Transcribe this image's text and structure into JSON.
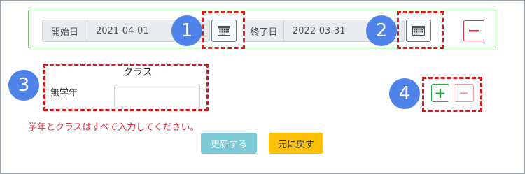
{
  "date_range": {
    "start_label": "開始日",
    "start_value": "2021-04-01",
    "end_label": "終了日",
    "end_value": "2022-03-31"
  },
  "class_section": {
    "header": "クラス",
    "grade_label": "無学年",
    "class_value": ""
  },
  "error_message": "学年とクラスはすべて入力してください。",
  "buttons": {
    "update": "更新する",
    "back": "元に戻す",
    "plus": "+",
    "minus": "−"
  },
  "badges": [
    "1",
    "2",
    "3",
    "4"
  ],
  "colors": {
    "panel_border": "#6cc46c",
    "dashed_highlight": "#d71920",
    "badge": "#4f83e9",
    "error_text": "#dc3545",
    "update_button": "#7ccad6",
    "back_button": "#ffc107",
    "plus": "#28a745",
    "minus": "#dc3545"
  },
  "icons": [
    "calendar-icon",
    "plus-icon",
    "minus-icon"
  ]
}
